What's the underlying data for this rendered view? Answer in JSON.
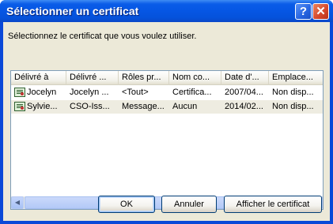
{
  "window": {
    "title": "Sélectionner un certificat",
    "help_label": "?",
    "close_label": "✕"
  },
  "instruction": "Sélectionnez le certificat que vous voulez utiliser.",
  "listview": {
    "columns": [
      "Délivré à",
      "Délivré ...",
      "Rôles pr...",
      "Nom co...",
      "Date d'...",
      "Emplace..."
    ],
    "rows": [
      [
        "Jocelyn",
        "Jocelyn ...",
        "<Tout>",
        "Certifica...",
        "2007/04...",
        "Non disp..."
      ],
      [
        "Sylvie...",
        "CSO-Iss...",
        "Message...",
        "Aucun",
        "2014/02...",
        "Non disp..."
      ]
    ]
  },
  "scrollbar": {
    "left_arrow": "◀",
    "right_arrow": "▶"
  },
  "buttons": {
    "ok": "OK",
    "cancel": "Annuler",
    "view": "Afficher le certificat"
  },
  "icons": {
    "row_icon": "certificate-icon"
  },
  "colors": {
    "titlebar": "#0656e4",
    "dialog_bg": "#ece9d8",
    "selected_row": "#eeece1"
  }
}
